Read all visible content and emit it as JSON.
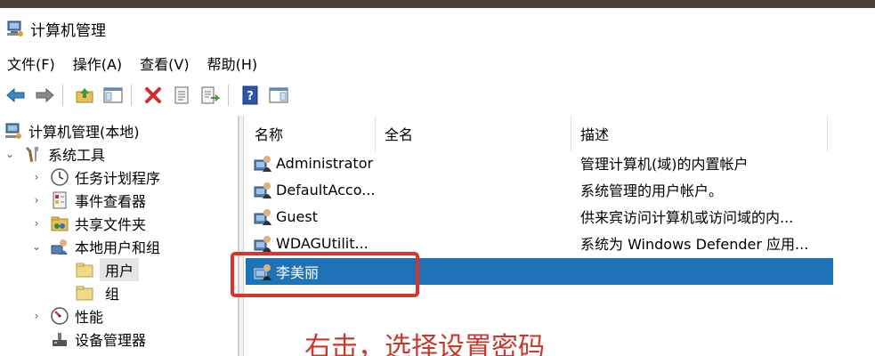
{
  "window": {
    "title": "计算机管理"
  },
  "menu": [
    "文件(F)",
    "操作(A)",
    "查看(V)",
    "帮助(H)"
  ],
  "tree": {
    "root": "计算机管理(本地)",
    "system_tools": "系统工具",
    "task_scheduler": "任务计划程序",
    "event_viewer": "事件查看器",
    "shared_folders": "共享文件夹",
    "local_users_groups": "本地用户和组",
    "users": "用户",
    "groups": "组",
    "performance": "性能",
    "device_manager": "设备管理器"
  },
  "list": {
    "columns": [
      "名称",
      "全名",
      "描述"
    ],
    "rows": [
      {
        "name": "Administrator",
        "full_name": "",
        "description": "管理计算机(域)的内置帐户"
      },
      {
        "name": "DefaultAcco...",
        "full_name": "",
        "description": "系统管理的用户帐户。"
      },
      {
        "name": "Guest",
        "full_name": "",
        "description": "供来宾访问计算机或访问域的内..."
      },
      {
        "name": "WDAGUtilit...",
        "full_name": "",
        "description": "系统为 Windows Defender 应用..."
      },
      {
        "name": "李美丽",
        "full_name": "",
        "description": ""
      }
    ],
    "selected_row": "李美丽"
  },
  "annotation": "右击，选择设置密码",
  "colors": {
    "selection": "#1e73b8",
    "annotation": "#c9382d"
  }
}
